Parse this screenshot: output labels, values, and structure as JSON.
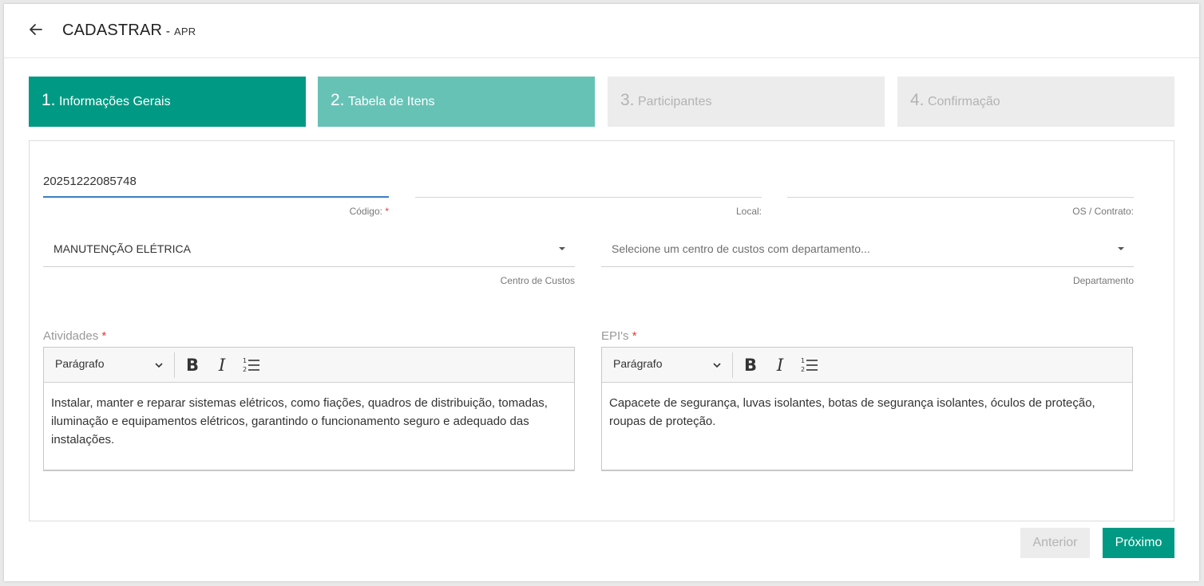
{
  "header": {
    "title": "CADASTRAR",
    "separator": " - ",
    "subtitle": "APR"
  },
  "steps": [
    {
      "number": "1.",
      "label": "Informações Gerais",
      "state": "active"
    },
    {
      "number": "2.",
      "label": "Tabela de Itens",
      "state": "next"
    },
    {
      "number": "3.",
      "label": "Participantes",
      "state": "inactive"
    },
    {
      "number": "4.",
      "label": "Confirmação",
      "state": "inactive"
    }
  ],
  "form": {
    "codigo": {
      "value": "20251222085748",
      "label": "Código:",
      "required": "*"
    },
    "local": {
      "value": "",
      "label": "Local:"
    },
    "os_contrato": {
      "value": "",
      "label": "OS / Contrato:"
    },
    "centro_custos": {
      "value": "MANUTENÇÃO ELÉTRICA",
      "label": "Centro de Custos"
    },
    "departamento": {
      "placeholder": "Selecione um centro de custos com departamento...",
      "label": "Departamento"
    },
    "atividades": {
      "label": "Atividades",
      "required": "*",
      "format": "Parágrafo",
      "content": "Instalar, manter e reparar sistemas elétricos, como fiações, quadros de distribuição, tomadas, iluminação e equipamentos elétricos, garantindo o funcionamento seguro e adequado das instalações."
    },
    "epis": {
      "label": "EPI's",
      "required": "*",
      "format": "Parágrafo",
      "content": "Capacete de segurança, luvas isolantes, botas de segurança isolantes, óculos de proteção, roupas de proteção."
    }
  },
  "toolbar": {
    "bold": "B",
    "italic": "I"
  },
  "buttons": {
    "prev": "Anterior",
    "next": "Próximo"
  },
  "colors": {
    "primary": "#009a84",
    "step_next": "#67c2b6",
    "step_inactive": "#ececec",
    "required": "#e53935",
    "active_underline": "#3a7fc4"
  }
}
